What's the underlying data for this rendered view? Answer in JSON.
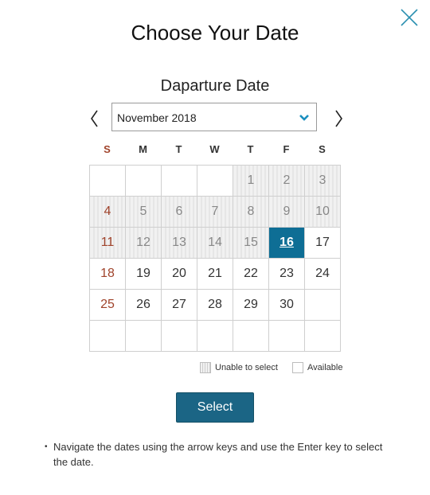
{
  "dialog": {
    "title": "Choose Your Date",
    "subtitle": "Daparture Date",
    "close_icon": "close-x-icon"
  },
  "navigation": {
    "prev_icon": "chevron-left-icon",
    "next_icon": "chevron-right-icon",
    "month_value": "November 2018",
    "dropdown_icon": "chevron-down-icon"
  },
  "weekdays": [
    "S",
    "M",
    "T",
    "W",
    "T",
    "F",
    "S"
  ],
  "calendar": {
    "rows": [
      [
        {
          "day": "",
          "state": "empty"
        },
        {
          "day": "",
          "state": "empty"
        },
        {
          "day": "",
          "state": "empty"
        },
        {
          "day": "",
          "state": "empty"
        },
        {
          "day": "1",
          "state": "unavailable"
        },
        {
          "day": "2",
          "state": "unavailable"
        },
        {
          "day": "3",
          "state": "unavailable"
        }
      ],
      [
        {
          "day": "4",
          "state": "unavailable"
        },
        {
          "day": "5",
          "state": "unavailable"
        },
        {
          "day": "6",
          "state": "unavailable"
        },
        {
          "day": "7",
          "state": "unavailable"
        },
        {
          "day": "8",
          "state": "unavailable"
        },
        {
          "day": "9",
          "state": "unavailable"
        },
        {
          "day": "10",
          "state": "unavailable"
        }
      ],
      [
        {
          "day": "11",
          "state": "unavailable"
        },
        {
          "day": "12",
          "state": "unavailable"
        },
        {
          "day": "13",
          "state": "unavailable"
        },
        {
          "day": "14",
          "state": "unavailable"
        },
        {
          "day": "15",
          "state": "unavailable"
        },
        {
          "day": "16",
          "state": "selected"
        },
        {
          "day": "17",
          "state": "available"
        }
      ],
      [
        {
          "day": "18",
          "state": "available"
        },
        {
          "day": "19",
          "state": "available"
        },
        {
          "day": "20",
          "state": "available"
        },
        {
          "day": "21",
          "state": "available"
        },
        {
          "day": "22",
          "state": "available"
        },
        {
          "day": "23",
          "state": "available"
        },
        {
          "day": "24",
          "state": "available"
        }
      ],
      [
        {
          "day": "25",
          "state": "available"
        },
        {
          "day": "26",
          "state": "available"
        },
        {
          "day": "27",
          "state": "available"
        },
        {
          "day": "28",
          "state": "available"
        },
        {
          "day": "29",
          "state": "available"
        },
        {
          "day": "30",
          "state": "available"
        },
        {
          "day": "",
          "state": "empty"
        }
      ],
      [
        {
          "day": "",
          "state": "empty"
        },
        {
          "day": "",
          "state": "empty"
        },
        {
          "day": "",
          "state": "empty"
        },
        {
          "day": "",
          "state": "empty"
        },
        {
          "day": "",
          "state": "empty"
        },
        {
          "day": "",
          "state": "empty"
        },
        {
          "day": "",
          "state": "empty"
        }
      ]
    ]
  },
  "legend": {
    "unavailable_label": "Unable to select",
    "available_label": "Available"
  },
  "select_button": "Select",
  "note": "Navigate the dates using the arrow keys and use the Enter key to select the date.",
  "colors": {
    "accent": "#0e6e95",
    "button": "#1b6585",
    "sunday": "#a0432b",
    "close_icon": "#2a8fb0"
  }
}
